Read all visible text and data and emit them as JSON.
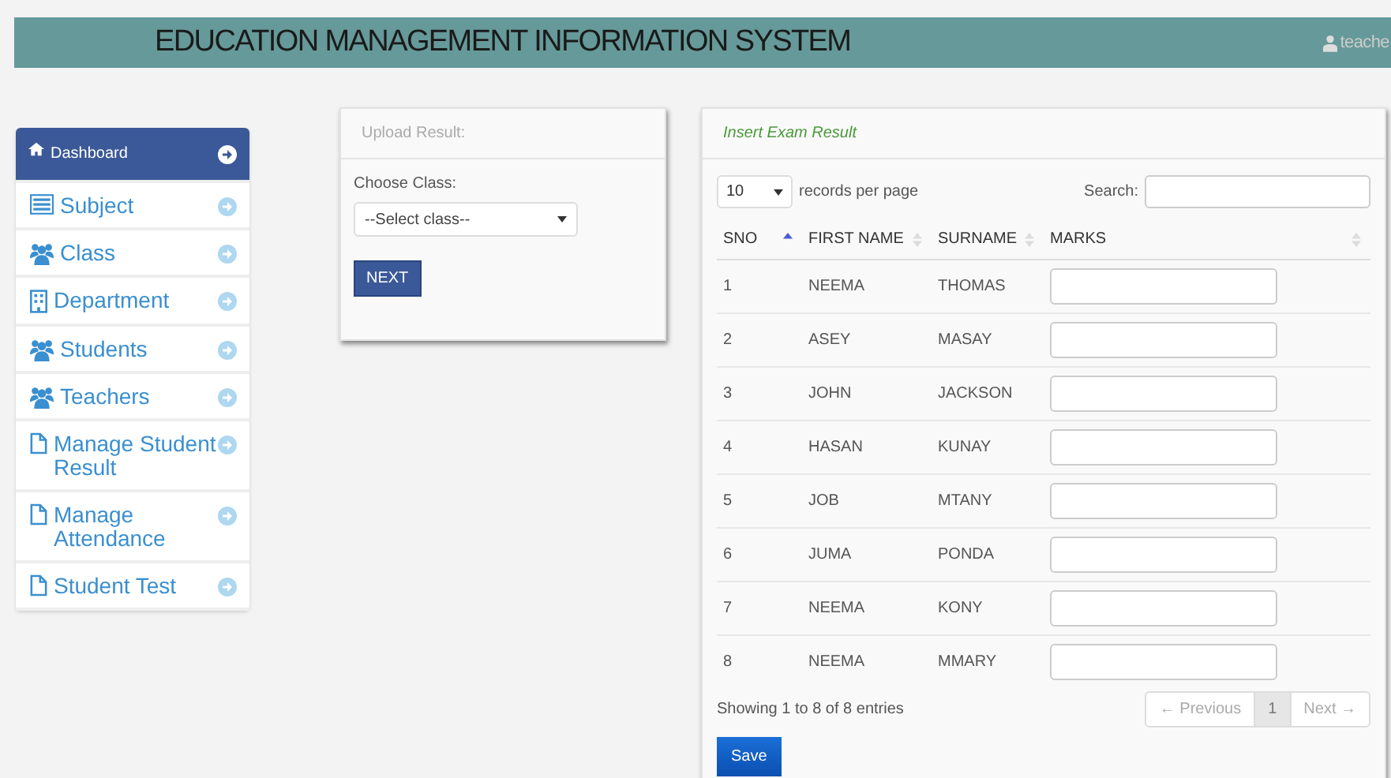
{
  "header": {
    "title": "EDUCATION MANAGEMENT INFORMATION SYSTEM",
    "user": "teache"
  },
  "sidebar": {
    "items": [
      {
        "label": "Dashboard",
        "kind": "home",
        "selected": true
      },
      {
        "label": "Subject",
        "kind": "list",
        "selected": false
      },
      {
        "label": "Class",
        "kind": "group",
        "selected": false
      },
      {
        "label": "Department",
        "kind": "building",
        "selected": false
      },
      {
        "label": "Students",
        "kind": "group",
        "selected": false
      },
      {
        "label": "Teachers",
        "kind": "group",
        "selected": false
      },
      {
        "label": "Manage Student Result",
        "kind": "file",
        "selected": false
      },
      {
        "label": "Manage Attendance",
        "kind": "file",
        "selected": false
      },
      {
        "label": "Student Test",
        "kind": "file",
        "selected": false
      }
    ]
  },
  "upload_panel": {
    "title": "Upload Result:",
    "field_label": "Choose Class:",
    "select_value": "--Select class--",
    "button": "NEXT"
  },
  "exam_panel": {
    "title": "Insert Exam Result",
    "page_size": "10",
    "page_size_label": "records per page",
    "search_label": "Search:",
    "columns": [
      {
        "label": "SNO",
        "sorted": true
      },
      {
        "label": "FIRST NAME",
        "sorted": false
      },
      {
        "label": "SURNAME",
        "sorted": false
      },
      {
        "label": "MARKS",
        "sorted": false
      }
    ],
    "rows": [
      {
        "sno": "1",
        "first_name": "NEEMA",
        "surname": "THOMAS"
      },
      {
        "sno": "2",
        "first_name": "ASEY",
        "surname": "MASAY"
      },
      {
        "sno": "3",
        "first_name": "JOHN",
        "surname": "JACKSON"
      },
      {
        "sno": "4",
        "first_name": "HASAN",
        "surname": "KUNAY"
      },
      {
        "sno": "5",
        "first_name": "JOB",
        "surname": "MTANY"
      },
      {
        "sno": "6",
        "first_name": "JUMA",
        "surname": "PONDA"
      },
      {
        "sno": "7",
        "first_name": "NEEMA",
        "surname": "KONY"
      },
      {
        "sno": "8",
        "first_name": "NEEMA",
        "surname": "MMARY"
      }
    ],
    "info": "Showing 1 to 8 of 8 entries",
    "pagination": [
      {
        "label": "← Previous",
        "selected": false
      },
      {
        "label": "1",
        "selected": true
      },
      {
        "label": "Next →",
        "selected": false
      }
    ],
    "save_button": "Save"
  }
}
